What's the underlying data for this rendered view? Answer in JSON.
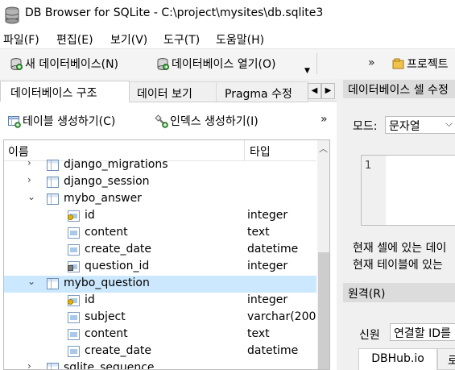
{
  "window": {
    "title": "DB Browser for SQLite - C:\\project\\mysites\\db.sqlite3"
  },
  "menu": [
    "파일(F)",
    "편집(E)",
    "보기(V)",
    "도구(T)",
    "도움말(H)"
  ],
  "toolbar": {
    "new_db": "새 데이터베이스(N)",
    "open_db": "데이터베이스 열기(O)",
    "overflow": "»",
    "project": "프로젝트"
  },
  "tabs": [
    "데이터베이스 구조",
    "데이터 보기",
    "Pragma 수정"
  ],
  "structure": {
    "create_table": "테이블 생성하기(C)",
    "create_index": "인덱스 생성하기(I)",
    "overflow": "»",
    "columns": {
      "name": "이름",
      "type": "타입"
    },
    "rows": [
      {
        "name": "django_migrations",
        "type": "",
        "kind": "table",
        "expander": "›",
        "indent": 1
      },
      {
        "name": "django_session",
        "type": "",
        "kind": "table",
        "expander": "›",
        "indent": 1
      },
      {
        "name": "mybo_answer",
        "type": "",
        "kind": "table",
        "expander": "⌄",
        "indent": 1
      },
      {
        "name": "id",
        "type": "integer",
        "kind": "pk",
        "expander": "",
        "indent": 2
      },
      {
        "name": "content",
        "type": "text",
        "kind": "field",
        "expander": "",
        "indent": 2
      },
      {
        "name": "create_date",
        "type": "datetime",
        "kind": "field",
        "expander": "",
        "indent": 2
      },
      {
        "name": "question_id",
        "type": "integer",
        "kind": "fk",
        "expander": "",
        "indent": 2
      },
      {
        "name": "mybo_question",
        "type": "",
        "kind": "table",
        "expander": "⌄",
        "indent": 1,
        "selected": true
      },
      {
        "name": "id",
        "type": "integer",
        "kind": "pk",
        "expander": "",
        "indent": 2
      },
      {
        "name": "subject",
        "type": "varchar(200",
        "kind": "field",
        "expander": "",
        "indent": 2
      },
      {
        "name": "content",
        "type": "text",
        "kind": "field",
        "expander": "",
        "indent": 2
      },
      {
        "name": "create_date",
        "type": "datetime",
        "kind": "field",
        "expander": "",
        "indent": 2
      },
      {
        "name": "sqlite_sequence",
        "type": "",
        "kind": "table",
        "expander": "›",
        "indent": 1
      }
    ]
  },
  "edit_cell": {
    "title": "데이터베이스 셀 수정",
    "mode_label": "모드:",
    "mode_value": "문자열",
    "line_number": "1",
    "info_line1": "현재 셀에 있는 데이",
    "info_line2": "현재 테이블에 있는"
  },
  "remote": {
    "title": "원격(R)",
    "identity_label": "신원",
    "identity_value": "연결할 ID를",
    "tabs": [
      "DBHub.io",
      "로"
    ]
  },
  "colors": {
    "selection": "#cce8ff",
    "accent": "#0078d7"
  }
}
